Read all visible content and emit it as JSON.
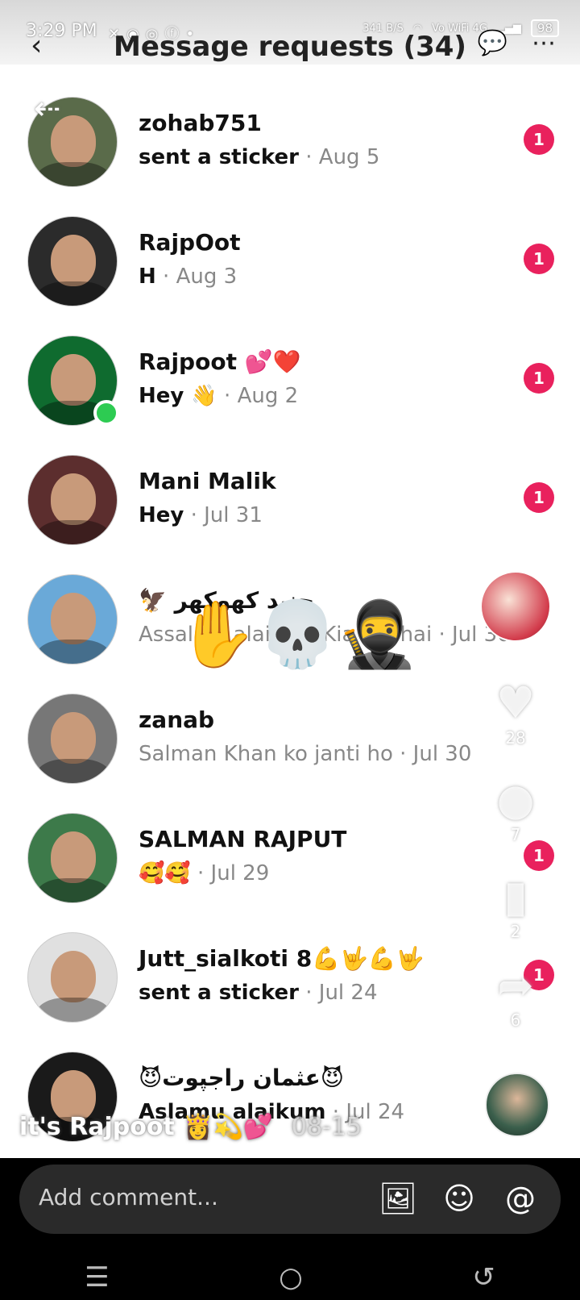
{
  "status_bar": {
    "time": "3:29 PM",
    "speed": "341 B/S",
    "network": "Vo WiFi 4G",
    "battery": "98"
  },
  "header": {
    "title": "Message requests (34)"
  },
  "requests": [
    {
      "name": "zohab751",
      "message": "sent a sticker",
      "date": "Aug 5",
      "unread": "1",
      "avatar_color": "#5a6b4a"
    },
    {
      "name": "RajpOot",
      "message": "H",
      "date": "Aug 3",
      "unread": "1",
      "avatar_color": "#2b2b2b"
    },
    {
      "name": "Rajpoot 💕❤️",
      "message": "Hey 👋",
      "date": "Aug 2",
      "unread": "1",
      "avatar_color": "#0f6b2f",
      "online": true
    },
    {
      "name": "Mani Malik",
      "message": "Hey",
      "date": "Jul 31",
      "unread": "1",
      "avatar_color": "#5c2e2e"
    },
    {
      "name": "🦅 جنید کھوکھر",
      "message": "Assalam alaikum Kia hal hai",
      "date": "Jul 30",
      "read": true,
      "avatar_color": "#6aa9d8"
    },
    {
      "name": "zanab",
      "message": "Salman Khan ko janti ho",
      "date": "Jul 30",
      "read": true,
      "avatar_color": "#777777"
    },
    {
      "name": "SALMAN RAJPUT",
      "message": "🥰🥰",
      "date": "Jul 29",
      "unread": "1",
      "avatar_color": "#3d7a4a"
    },
    {
      "name": "Jutt_sialkoti 8💪🤟💪🤟",
      "message": "sent a sticker",
      "date": "Jul 24",
      "unread": "1",
      "avatar_color": "#e0e0e0"
    },
    {
      "name": "😈عثمان راجپوت😈",
      "message": "Aslamu alaikum",
      "date": "Jul 24",
      "avatar_color": "#1a1a1a"
    }
  ],
  "video_overlay": {
    "likes": "28",
    "comments": "7",
    "saves": "2",
    "shares": "6",
    "caption": "it's Rajpoot 👸💫💕",
    "caption_date": "08-15",
    "progress": 0.24,
    "stickers": "✋💀🥷"
  },
  "comment_bar": {
    "placeholder": "Add comment..."
  }
}
